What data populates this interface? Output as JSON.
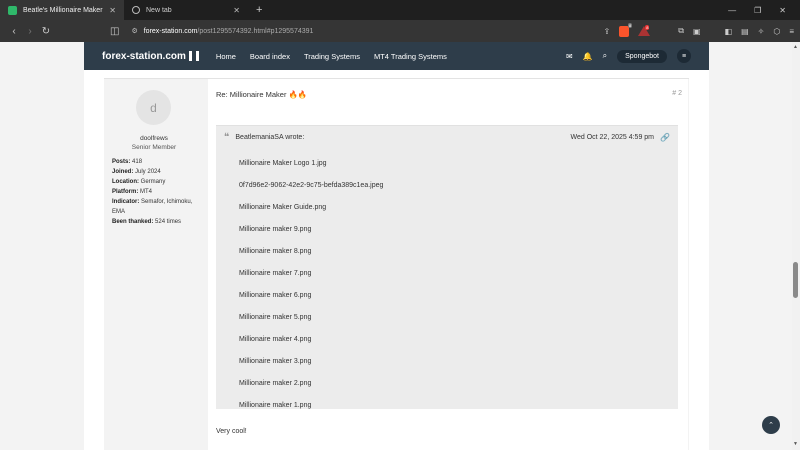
{
  "tabs": [
    {
      "title": "Beatle's Millionaire Maker 🔥🔥",
      "active": true
    },
    {
      "title": "New tab",
      "active": false
    }
  ],
  "address": {
    "host": "forex-station.com",
    "path": "/post1295574392.html#p1295574391"
  },
  "badges": {
    "brave_count": "8",
    "alert_count": "8"
  },
  "site": {
    "logo": "forex-station.com",
    "nav": [
      "Home",
      "Board index",
      "Trading Systems",
      "MT4 Trading Systems"
    ],
    "username": "Spongebot"
  },
  "author": {
    "avatar_letter": "d",
    "name": "doolfrews",
    "rank": "Senior Member",
    "details": [
      {
        "label": "Posts:",
        "value": "418"
      },
      {
        "label": "Joined:",
        "value": "July 2024"
      },
      {
        "label": "Location:",
        "value": "Germany"
      },
      {
        "label": "Platform:",
        "value": "MT4"
      },
      {
        "label": "Indicator:",
        "value": "Semafor, Ichimoku, EMA"
      },
      {
        "label": "Been thanked:",
        "value": "524 times"
      }
    ]
  },
  "post": {
    "title": "Re: Millionaire Maker 🔥🔥",
    "number": "# 2",
    "quote": {
      "author": "BeatlemaniaSA wrote:",
      "date": "Wed Oct 22, 2025 4:59 pm",
      "files": [
        "Millionaire Maker Logo 1.jpg",
        "0f7d96e2-9062-42e2-9c75-befda389c1ea.jpeg",
        "Millionaire Maker Guide.png",
        "Millionaire maker 9.png",
        "Millionaire maker 8.png",
        "Millionaire maker 7.png",
        "Millionaire maker 6.png",
        "Millionaire maker 5.png",
        "Millionaire maker 4.png",
        "Millionaire maker 3.png",
        "Millionaire maker 2.png",
        "Millionaire maker 1.png"
      ]
    },
    "reply": "Very cool!"
  },
  "colors": {
    "header_bg": "#2e3d4a",
    "tab_active": "#353535",
    "chrome_bg": "#1f1f1f"
  }
}
